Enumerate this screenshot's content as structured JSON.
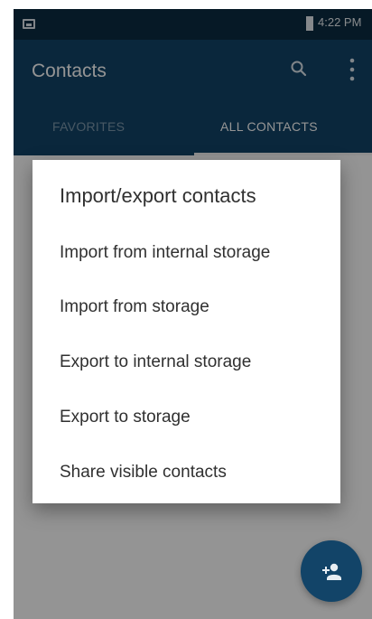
{
  "status_bar": {
    "time": "4:22 PM",
    "icons": [
      "image-icon",
      "battery-icon"
    ]
  },
  "app_bar": {
    "title": "Contacts",
    "icons": [
      "search-icon",
      "more-vert-icon"
    ]
  },
  "tabs": [
    {
      "label": "FAVORITES"
    },
    {
      "label": "ALL CONTACTS"
    }
  ],
  "dialog": {
    "title": "Import/export contacts",
    "items": [
      {
        "label": "Import from internal storage"
      },
      {
        "label": "Import from storage"
      },
      {
        "label": "Export to internal storage"
      },
      {
        "label": "Export to storage"
      },
      {
        "label": "Share visible contacts"
      }
    ]
  },
  "fab": {
    "icon": "add-contact-icon"
  }
}
